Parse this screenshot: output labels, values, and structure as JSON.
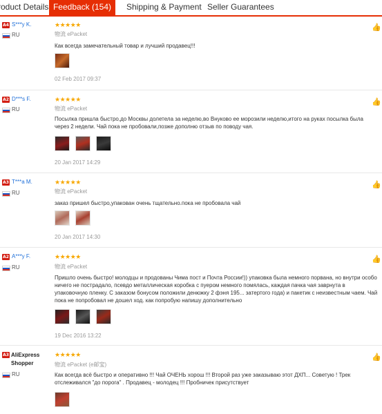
{
  "tabs": [
    {
      "label": "roduct Details"
    },
    {
      "label": "Feedback (154)"
    },
    {
      "label": "Shipping & Payment"
    },
    {
      "label": "Seller Guarantees"
    }
  ],
  "colors": {
    "accent": "#e62e04",
    "stars": "#f7a700",
    "name_link": "#1e6fd9",
    "badge": "#d31e13"
  },
  "reviews": [
    {
      "badge": "A4",
      "name": "S***y K.",
      "country": "RU",
      "stars": "★★★★★",
      "shipping": "物流 ePacket",
      "text": "Как всегда замечательный товар и лучший продавец!!!",
      "date": "02 Feb 2017 09:37"
    },
    {
      "badge": "A2",
      "name": "D***s F.",
      "country": "RU",
      "stars": "★★★★★",
      "shipping": "物流 ePacket",
      "text": "Посылка пришла быстро,до Москвы долетела за неделю,во Внуково ее морозили неделю,итого на руках посылка была через 2 недели. Чай пока не пробовали,позже дополню отзыв по поводу чая.",
      "date": "20 Jan 2017 14:29"
    },
    {
      "badge": "A3",
      "name": "T***a M.",
      "country": "RU",
      "stars": "★★★★★",
      "shipping": "物流 ePacket",
      "text": "заказ пришел быстро,упакован очень тщательно.пока не пробовала чай",
      "date": "20 Jan 2017 14:30"
    },
    {
      "badge": "A2",
      "name": "A***y F.",
      "country": "RU",
      "stars": "★★★★★",
      "shipping": "物流 ePacket",
      "text": "Пришло очень быстро! молодцы и продованы Чима пост и Почта России!)) упаковка была немного порвана, но внутри особо ничего не пострадало, псевдо металлическая коробка с пуером немного помялась, каждая пачка чая заврнута в упаковочную пленку. С заказом бонусом положили денюжку 2 фэня 195... затертого года) и пакетик с неизвестным чаем. Чай пока не попробовал не дошел ход. как попробую напишу дополнительно",
      "date": "19 Dec 2016 13:22"
    },
    {
      "badge": "A3",
      "name": "AliExpress Shopper",
      "country": "RU",
      "stars": "★★★★★",
      "shipping": "物流 ePacket (e邮宝)",
      "text": "Как всегда всё быстро и оперативно !!! Чай ОЧЕНЬ хорош !!! Второй раз уже заказываю этот ДХП... Советую ! Трек отслеживался \"до порога\" . Продавец - молодец !!! Пробничек присутствует",
      "date": ""
    }
  ]
}
